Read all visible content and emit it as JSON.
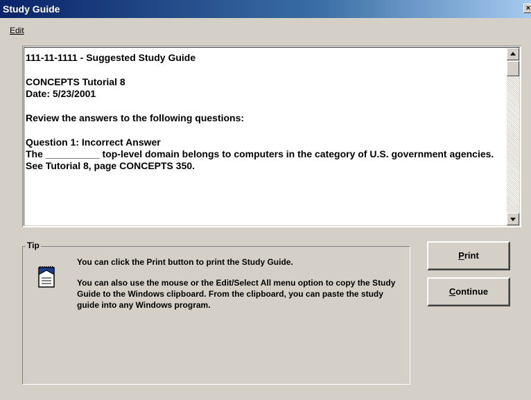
{
  "window": {
    "title": "Study Guide",
    "close_glyph": "×"
  },
  "menu": {
    "items": [
      {
        "label": "Edit"
      }
    ]
  },
  "study_text": {
    "heading": "111-11-1111 - Suggested Study Guide",
    "tutorial": "CONCEPTS Tutorial 8",
    "date": "Date: 5/23/2001",
    "instruction": "Review the answers to the following questions:",
    "question_title": "Question  1: Incorrect Answer",
    "question_body": "The __________ top-level domain belongs to computers in the category of U.S. government agencies.",
    "reference": "See Tutorial 8, page CONCEPTS 350."
  },
  "tip": {
    "legend": "Tip",
    "icon": "notepad-icon",
    "line1": "You can click the Print button to print the Study Guide.",
    "line2": "You can also use the mouse or the Edit/Select All menu option to copy the Study Guide to the Windows clipboard. From the clipboard, you can paste the study guide into any Windows program."
  },
  "buttons": {
    "print": {
      "accel": "P",
      "rest": "rint"
    },
    "continue": {
      "accel": "C",
      "rest": "ontinue"
    }
  },
  "colors": {
    "window_bg": "#d4d0c8",
    "title_start": "#0a246a",
    "title_end": "#a6caf0"
  }
}
